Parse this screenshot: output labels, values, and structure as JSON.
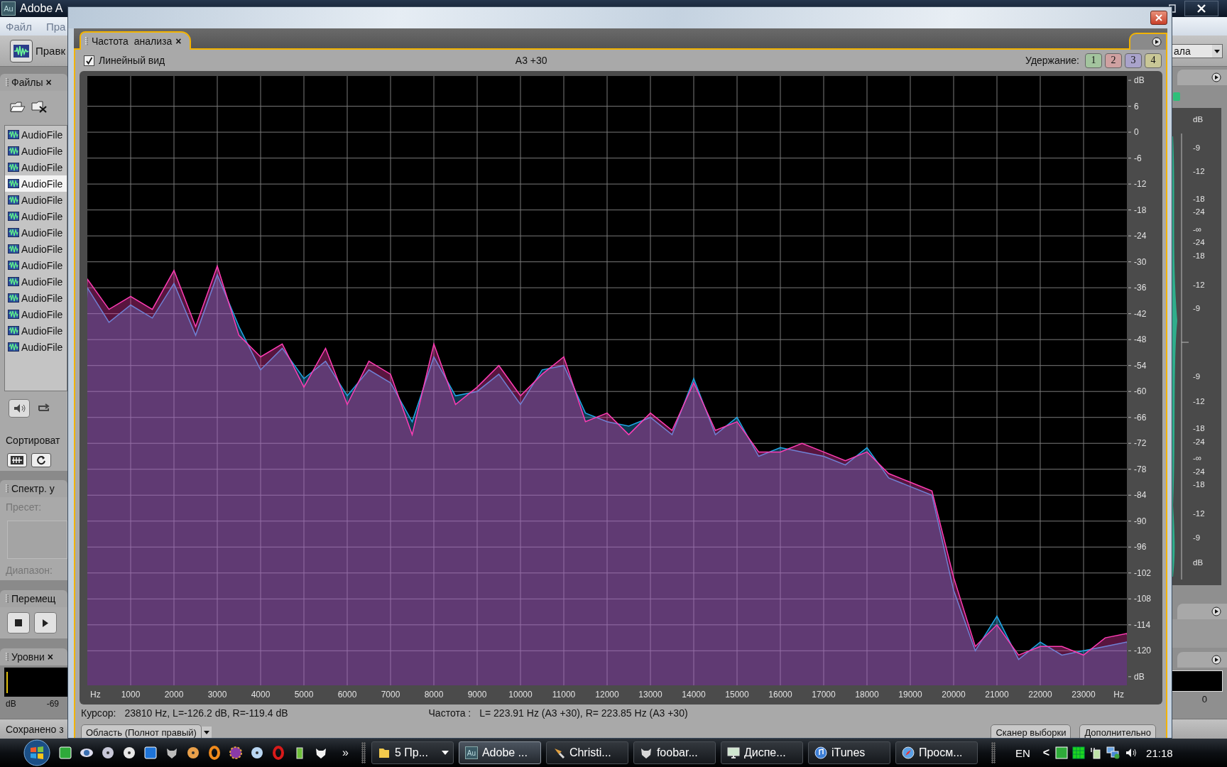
{
  "app": {
    "logo_text": "Au",
    "title": "Adobe A",
    "menu": [
      "Файл",
      "Пра"
    ],
    "toolbar_label": "Правк",
    "dropdown": "ала",
    "status": "Сохранено з"
  },
  "files_panel": {
    "title": "Файлы",
    "close": "×",
    "items": [
      {
        "name": "AudioFile",
        "selected": false
      },
      {
        "name": "AudioFile",
        "selected": false
      },
      {
        "name": "AudioFile",
        "selected": false
      },
      {
        "name": "AudioFile",
        "selected": true
      },
      {
        "name": "AudioFile",
        "selected": false
      },
      {
        "name": "AudioFile",
        "selected": false
      },
      {
        "name": "AudioFile",
        "selected": false
      },
      {
        "name": "AudioFile",
        "selected": false
      },
      {
        "name": "AudioFile",
        "selected": false
      },
      {
        "name": "AudioFile",
        "selected": false
      },
      {
        "name": "AudioFile",
        "selected": false
      },
      {
        "name": "AudioFile",
        "selected": false
      },
      {
        "name": "AudioFile",
        "selected": false
      },
      {
        "name": "AudioFile",
        "selected": false
      }
    ],
    "sort_label": "Сортироват"
  },
  "spectrum_panel": {
    "title": "Спектр. у",
    "preset_label": "Пресет:",
    "range_label": "Диапазон:"
  },
  "transport_panel": {
    "title": "Перемещ"
  },
  "levels_panel": {
    "title": "Уровни",
    "close": "×",
    "scale": [
      "dB",
      "-69"
    ]
  },
  "right_meter": {
    "labels": [
      "dB",
      "-9",
      "-12",
      "-18",
      "-24",
      "-∞",
      "-24",
      "-18",
      "-12",
      "-9",
      "-9",
      "-12",
      "-18",
      "-24",
      "-∞",
      "-24",
      "-18",
      "-12",
      "-9",
      "dB"
    ],
    "level_scale": "0"
  },
  "analysis_window": {
    "tab": {
      "title": "Частота  анализа",
      "close": "×",
      "selected": true
    },
    "linear_view": {
      "label": "Линейный вид",
      "checked": true
    },
    "reference": "A3 +30",
    "hold_label": "Удержание:",
    "hold_buttons": [
      {
        "label": "1",
        "color": "#a3c49e"
      },
      {
        "label": "2",
        "color": "#cfa1a1"
      },
      {
        "label": "3",
        "color": "#a9a3cb"
      },
      {
        "label": "4",
        "color": "#c9c796"
      }
    ],
    "chart_data": {
      "type": "area",
      "grid": true,
      "xlim": [
        0,
        24000
      ],
      "ylim": [
        -128,
        13
      ],
      "x": [
        0,
        500,
        1000,
        1500,
        2000,
        2500,
        3000,
        3500,
        4000,
        4500,
        5000,
        5500,
        6000,
        6500,
        7000,
        7500,
        8000,
        8500,
        9000,
        9500,
        10000,
        10500,
        11000,
        11500,
        12000,
        12500,
        13000,
        13500,
        14000,
        14500,
        15000,
        15500,
        16000,
        16500,
        17000,
        17500,
        18000,
        18500,
        19000,
        19500,
        20000,
        20500,
        21000,
        21500,
        22000,
        22500,
        23000,
        23500,
        24000
      ],
      "series": [
        {
          "color": "#22a6e6",
          "values": [
            -36,
            -44,
            -40,
            -43,
            -35,
            -47,
            -33,
            -45,
            -55,
            -50,
            -57,
            -53,
            -61,
            -55,
            -58,
            -67,
            -52,
            -61,
            -60,
            -56,
            -63,
            -55,
            -54,
            -65,
            -67,
            -68,
            -66,
            -70,
            -57,
            -70,
            -66,
            -75,
            -73,
            -74,
            -75,
            -77,
            -73,
            -80,
            -82,
            -84,
            -106,
            -120,
            -112,
            -122,
            -118,
            -121,
            -120,
            -119,
            -118
          ]
        },
        {
          "color": "#ff3cb4",
          "values": [
            -34,
            -41,
            -38,
            -41,
            -32,
            -45,
            -31,
            -47,
            -52,
            -49,
            -59,
            -50,
            -63,
            -53,
            -56,
            -70,
            -49,
            -63,
            -59,
            -54,
            -61,
            -56,
            -52,
            -67,
            -65,
            -70,
            -65,
            -69,
            -58,
            -69,
            -67,
            -74,
            -74,
            -72,
            -74,
            -76,
            -74,
            -79,
            -81,
            -83,
            -103,
            -119,
            -114,
            -121,
            -119,
            -119,
            -121,
            -117,
            -116
          ]
        }
      ],
      "xticks": [
        {
          "value": 0,
          "label": "Hz"
        },
        1000,
        2000,
        3000,
        4000,
        5000,
        6000,
        7000,
        8000,
        9000,
        10000,
        11000,
        12000,
        13000,
        14000,
        15000,
        16000,
        17000,
        18000,
        19000,
        20000,
        21000,
        22000,
        23000,
        {
          "value": 24000,
          "label": "Hz"
        }
      ],
      "yticks": [
        {
          "value": 12,
          "label": "dB"
        },
        6,
        0,
        -6,
        -12,
        -18,
        -24,
        -30,
        -36,
        -42,
        -48,
        -54,
        -60,
        -66,
        -72,
        -78,
        -84,
        -90,
        -96,
        -102,
        -108,
        -114,
        -120,
        {
          "value": -126,
          "label": "dB"
        }
      ]
    },
    "cursor_label": "Курсор:",
    "cursor_value": "23810 Hz, L=-126.2 dB, R=-119.4 dB",
    "frequency_label": "Частота :",
    "frequency_value": "L= 223.91 Hz (A3 +30), R= 223.85 Hz (A3 +30)",
    "buttons": [
      {
        "label": "Область (Полнот правый)",
        "kind": "dropdown"
      },
      {
        "label": "Сканер выборки",
        "kind": "plain"
      },
      {
        "label": "Дополнительно",
        "kind": "plain"
      }
    ]
  },
  "taskbar": {
    "tasks": [
      {
        "label": "5 Пр...",
        "selected": false,
        "kind": "group"
      },
      {
        "label": "Adobe ...",
        "selected": true,
        "kind": "single"
      },
      {
        "label": "Christi...",
        "selected": false,
        "kind": "single"
      },
      {
        "label": "foobar...",
        "selected": false,
        "kind": "single"
      },
      {
        "label": "Диспе...",
        "selected": false,
        "kind": "single"
      },
      {
        "label": "iTunes",
        "selected": false,
        "kind": "single"
      },
      {
        "label": "Просм...",
        "selected": false,
        "kind": "single"
      }
    ],
    "icon_text": "Au",
    "overflow": "»",
    "language": "EN",
    "tray_arrow": "<",
    "clock": "21:18"
  }
}
